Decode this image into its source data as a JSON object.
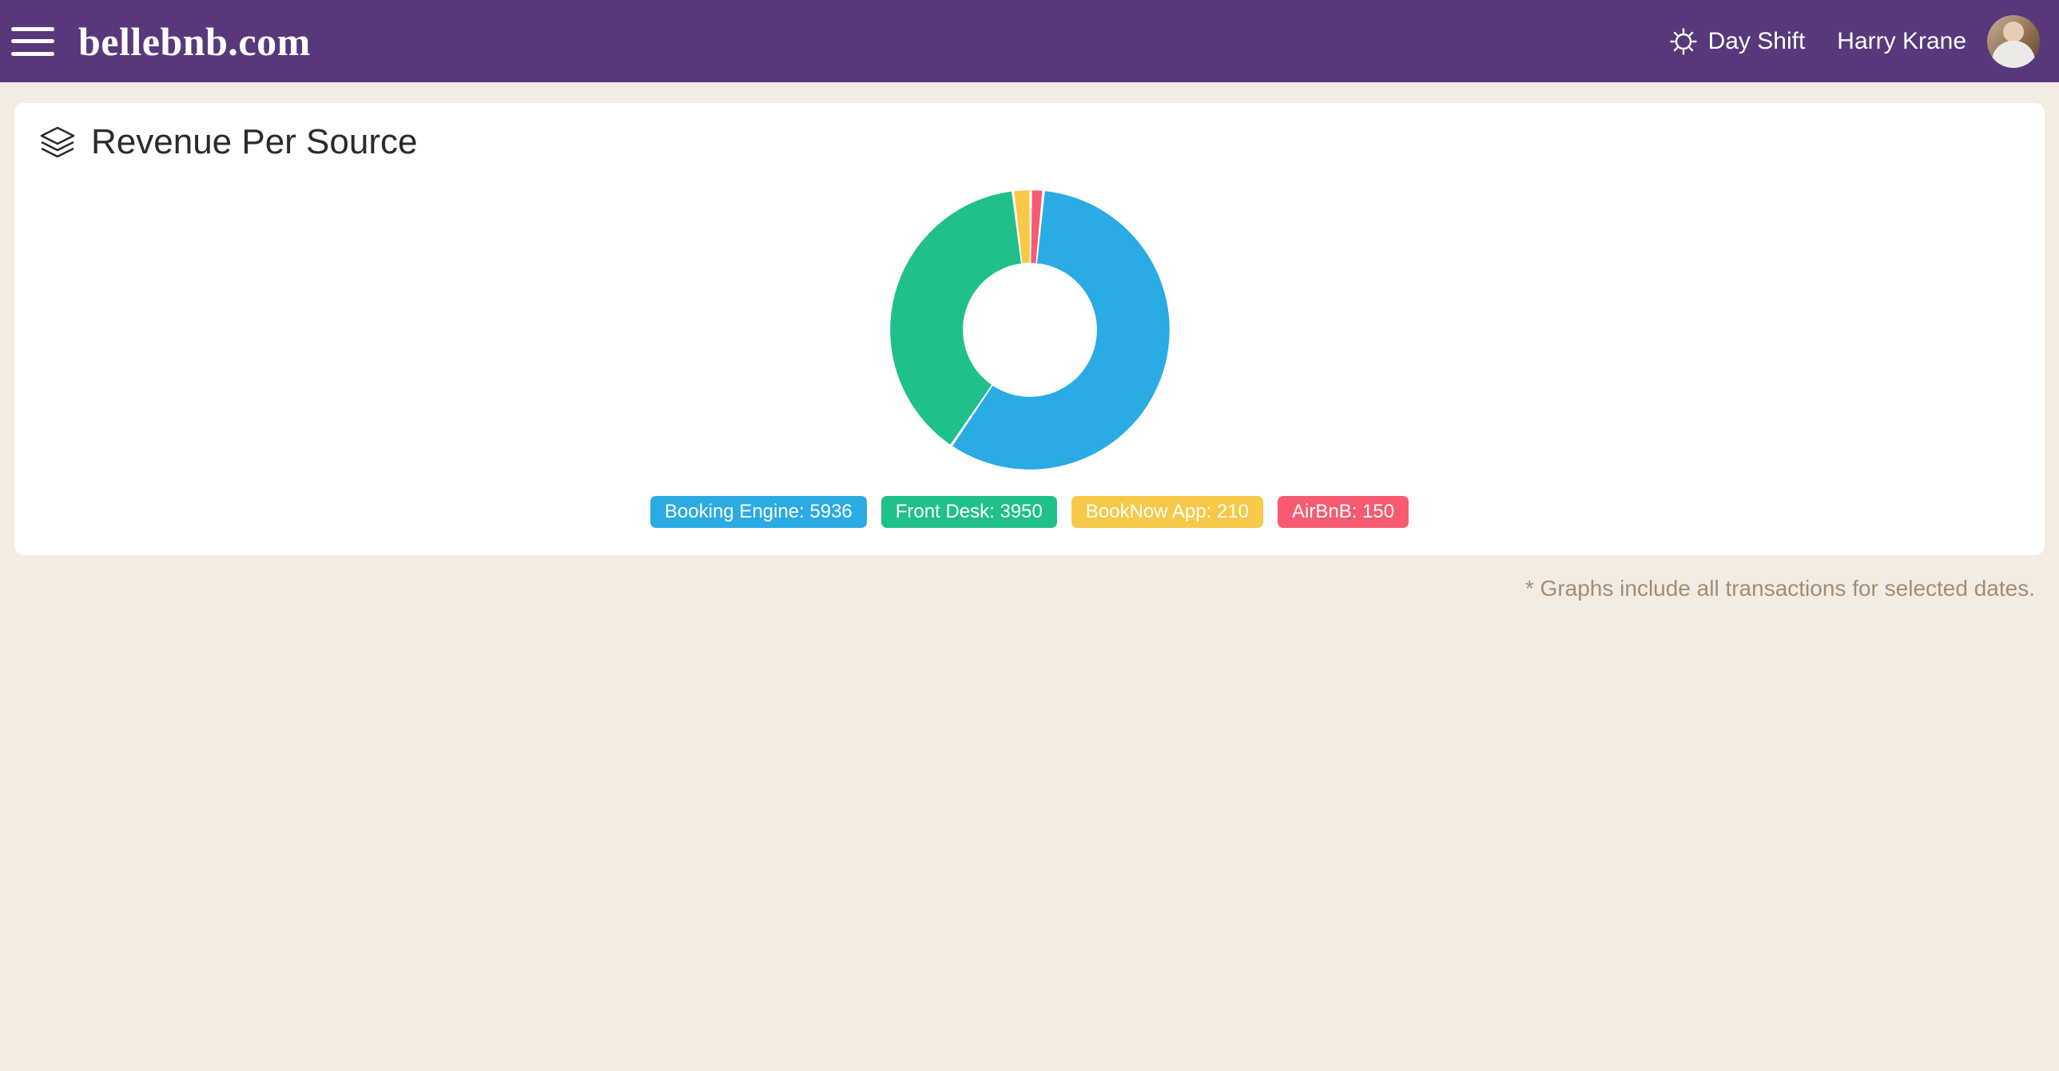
{
  "header": {
    "brand": "bellebnb.com",
    "shift_label": "Day Shift",
    "user_name": "Harry Krane"
  },
  "card": {
    "title": "Revenue Per Source"
  },
  "footnote": "* Graphs include all transactions for selected dates.",
  "chart_data": {
    "type": "pie",
    "title": "Revenue Per Source",
    "series": [
      {
        "name": "Booking Engine",
        "value": 5936,
        "color": "#2aabe4"
      },
      {
        "name": "Front Desk",
        "value": 3950,
        "color": "#20c08b"
      },
      {
        "name": "BookNow App",
        "value": 210,
        "color": "#f7c948"
      },
      {
        "name": "AirBnB",
        "value": 150,
        "color": "#f65b72"
      }
    ],
    "donut_inner_ratio": 0.48
  }
}
